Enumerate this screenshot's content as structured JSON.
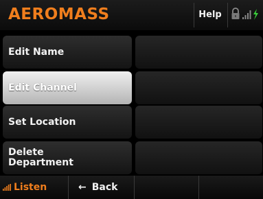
{
  "header": {
    "brand": "AEROMASS",
    "help_label": "Help",
    "status_icons": [
      "lock-icon",
      "signal-bars-icon",
      "charging-icon"
    ]
  },
  "menu": {
    "items": [
      {
        "label": "Edit Name",
        "active": false,
        "value": ""
      },
      {
        "label": "Edit Channel",
        "active": true,
        "value": ""
      },
      {
        "label": "Set Location",
        "active": false,
        "value": ""
      },
      {
        "label": "Delete Department",
        "active": false,
        "value": ""
      }
    ]
  },
  "footer": {
    "listen_label": "Listen",
    "back_label": "Back",
    "back_arrow": "←"
  },
  "colors": {
    "accent": "#f07e1d",
    "charging": "#3bd23b",
    "text": "#f2f2f2"
  }
}
